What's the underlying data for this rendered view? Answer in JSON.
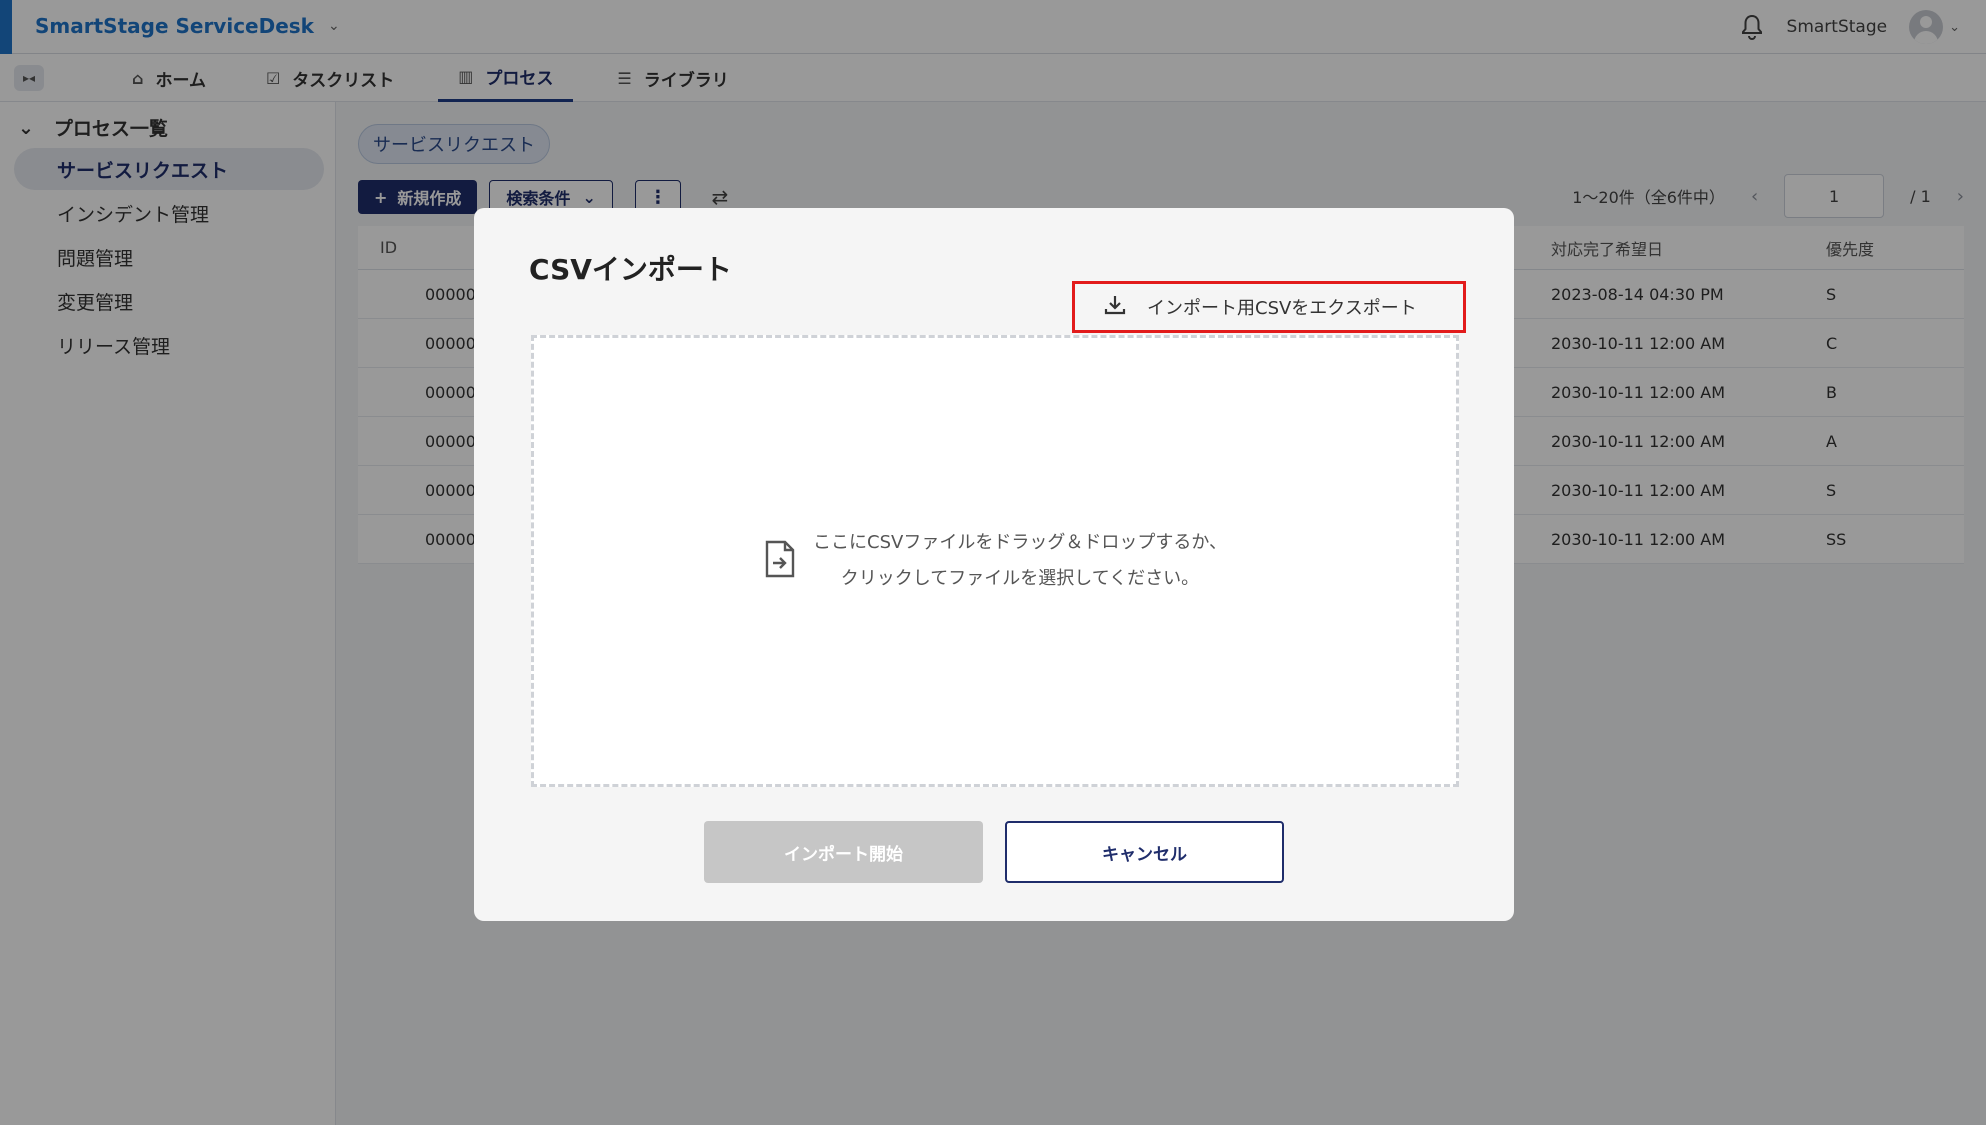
{
  "app": {
    "title": "SmartStage ServiceDesk",
    "user_name": "SmartStage",
    "accent_color": "#1f73c8",
    "primary_color": "#1f2d6b"
  },
  "nav": {
    "tabs": [
      {
        "label": "ホーム",
        "icon": "home-icon"
      },
      {
        "label": "タスクリスト",
        "icon": "checklist-icon"
      },
      {
        "label": "プロセス",
        "icon": "process-icon",
        "active": true
      },
      {
        "label": "ライブラリ",
        "icon": "list-icon"
      }
    ]
  },
  "sidebar": {
    "header": "プロセス一覧",
    "items": [
      {
        "label": "サービスリクエスト",
        "active": true
      },
      {
        "label": "インシデント管理"
      },
      {
        "label": "問題管理"
      },
      {
        "label": "変更管理"
      },
      {
        "label": "リリース管理"
      }
    ]
  },
  "main": {
    "chip": "サービスリクエスト",
    "new_button": "新規作成",
    "search_button": "検索条件",
    "pager": {
      "summary": "1〜20件（全6件中）",
      "page": "1",
      "total": "/ 1"
    },
    "table": {
      "headers": {
        "id": "ID",
        "due": "対応完了希望日",
        "priority": "優先度"
      },
      "rows": [
        {
          "id": "00000",
          "due": "2023-08-14 04:30 PM",
          "priority": "S"
        },
        {
          "id": "00000",
          "due": "2030-10-11 12:00 AM",
          "priority": "C"
        },
        {
          "id": "00000",
          "due": "2030-10-11 12:00 AM",
          "priority": "B"
        },
        {
          "id": "00000",
          "due": "2030-10-11 12:00 AM",
          "priority": "A"
        },
        {
          "id": "00000",
          "due": "2030-10-11 12:00 AM",
          "priority": "S"
        },
        {
          "id": "00000",
          "due": "2030-10-11 12:00 AM",
          "priority": "SS"
        }
      ]
    }
  },
  "modal": {
    "title": "CSVインポート",
    "export_button": "インポート用CSVをエクスポート",
    "drop_line1": "ここにCSVファイルをドラッグ＆ドロップするか、",
    "drop_line2": "クリックしてファイルを選択してください。",
    "start_button": "インポート開始",
    "cancel_button": "キャンセル",
    "highlight_color": "#e21b1b"
  }
}
